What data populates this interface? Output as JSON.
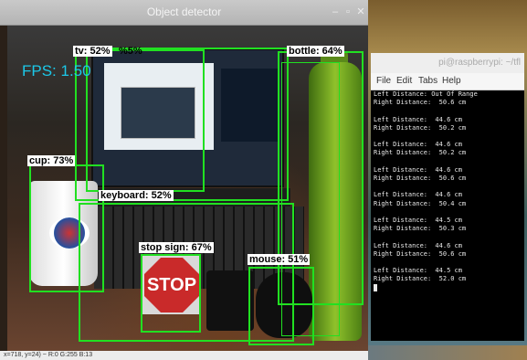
{
  "detector": {
    "title": "Object detector",
    "fps_label": "FPS: 1.50",
    "status_text": "x=718, y=24) ~ R:0 G:255 B:13",
    "detections": [
      {
        "id": "tv",
        "label": "tv: 52%"
      },
      {
        "id": "laptop",
        "label": "%5%"
      },
      {
        "id": "bottle",
        "label": "bottle: 64%"
      },
      {
        "id": "cup",
        "label": "cup: 73%"
      },
      {
        "id": "keyboard",
        "label": "keyboard: 52%"
      },
      {
        "id": "stop_sign",
        "label": "stop sign: 67%"
      },
      {
        "id": "mouse",
        "label": "mouse: 51%"
      }
    ],
    "stop_sign_text": "STOP",
    "box_color": "#21e021",
    "fps_color": "#1cc8e8"
  },
  "terminal": {
    "title": "pi@raspberrypi: ~/tfl",
    "menu": [
      "File",
      "Edit",
      "Tabs",
      "Help"
    ],
    "lines": [
      "Left Distance: Out Of Range",
      "Right Distance:  50.6 cm",
      "",
      "Left Distance:  44.6 cm",
      "Right Distance:  50.2 cm",
      "",
      "Left Distance:  44.6 cm",
      "Right Distance:  50.2 cm",
      "",
      "Left Distance:  44.6 cm",
      "Right Distance:  50.6 cm",
      "",
      "Left Distance:  44.6 cm",
      "Right Distance:  50.4 cm",
      "",
      "Left Distance:  44.5 cm",
      "Right Distance:  50.3 cm",
      "",
      "Left Distance:  44.6 cm",
      "Right Distance:  50.6 cm",
      "",
      "Left Distance:  44.5 cm",
      "Right Distance:  52.0 cm"
    ]
  }
}
